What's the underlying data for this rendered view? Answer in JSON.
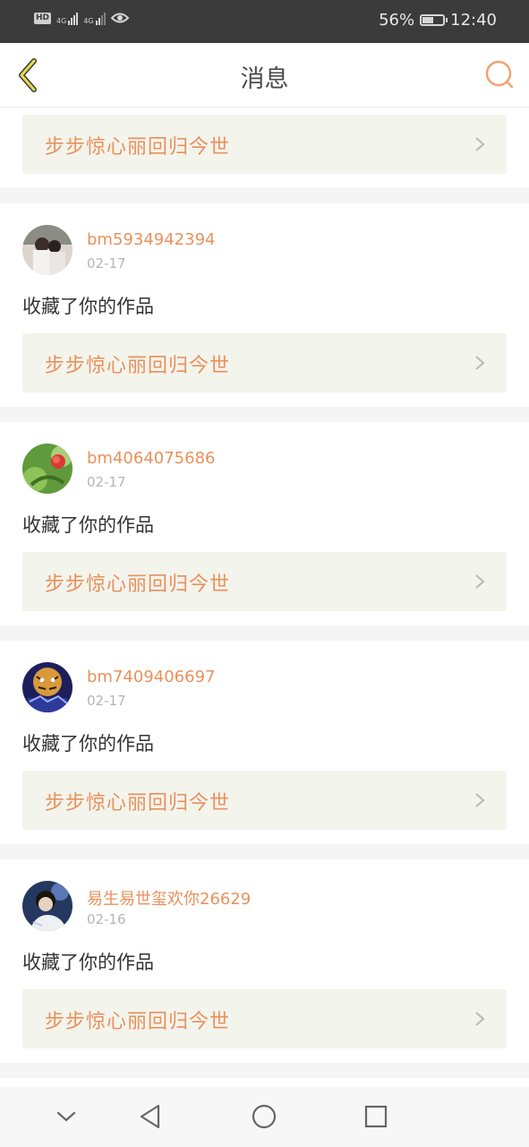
{
  "status_bar": {
    "hd": "HD",
    "net1": "4G",
    "net2": "4G",
    "battery_text": "56%",
    "battery_level": 0.56,
    "time": "12:40"
  },
  "nav": {
    "title": "消息",
    "back_icon": "chevron-left-icon",
    "search_icon": "search-icon"
  },
  "top_card": {
    "work_title": "步步惊心丽回归今世"
  },
  "messages": [
    {
      "username": "bm5934942394",
      "date": "02-17",
      "text": "收藏了你的作品",
      "work_title": "步步惊心丽回归今世"
    },
    {
      "username": "bm4064075686",
      "date": "02-17",
      "text": "收藏了你的作品",
      "work_title": "步步惊心丽回归今世"
    },
    {
      "username": "bm7409406697",
      "date": "02-17",
      "text": "收藏了你的作品",
      "work_title": "步步惊心丽回归今世"
    },
    {
      "username": "易生易世玺欢你26629",
      "date": "02-16",
      "text": "收藏了你的作品",
      "work_title": "步步惊心丽回归今世"
    }
  ],
  "system_nav": {
    "icons": [
      "chevron-down-icon",
      "back-triangle-icon",
      "home-circle-icon",
      "recents-square-icon"
    ]
  },
  "colors": {
    "accent": "#e8915c",
    "link_bg": "#f3f4ec",
    "status_bar_bg": "#3b3b3b"
  }
}
